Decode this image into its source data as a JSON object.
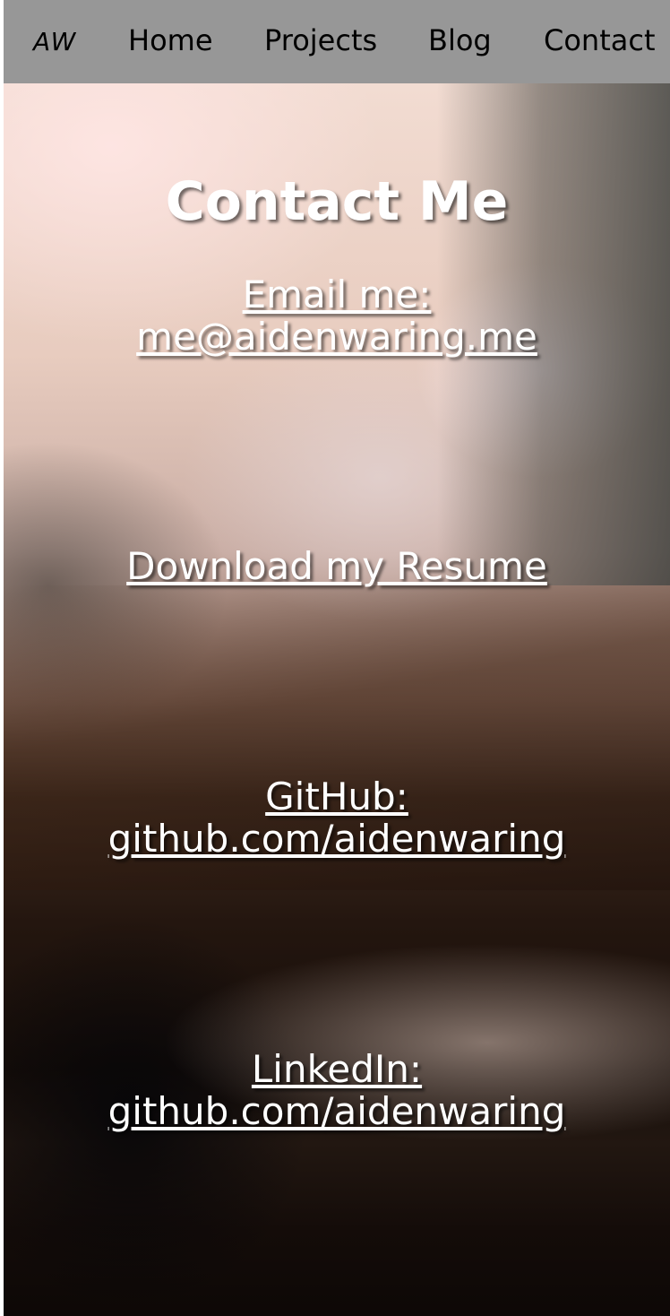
{
  "nav": {
    "logo": "AW",
    "links": [
      "Home",
      "Projects",
      "Blog",
      "Contact"
    ]
  },
  "contact": {
    "title": "Contact Me",
    "email": {
      "label": "Email me:",
      "value": "me@aidenwaring.me"
    },
    "resume": {
      "label": "Download my Resume"
    },
    "github": {
      "label": "GitHub:",
      "value": "github.com/aidenwaring"
    },
    "linkedin": {
      "label": "LinkedIn:",
      "value": "github.com/aidenwaring"
    }
  },
  "colors": {
    "navbar_bg": "#979797",
    "nav_text": "#000000",
    "content_text": "#ffffff"
  }
}
